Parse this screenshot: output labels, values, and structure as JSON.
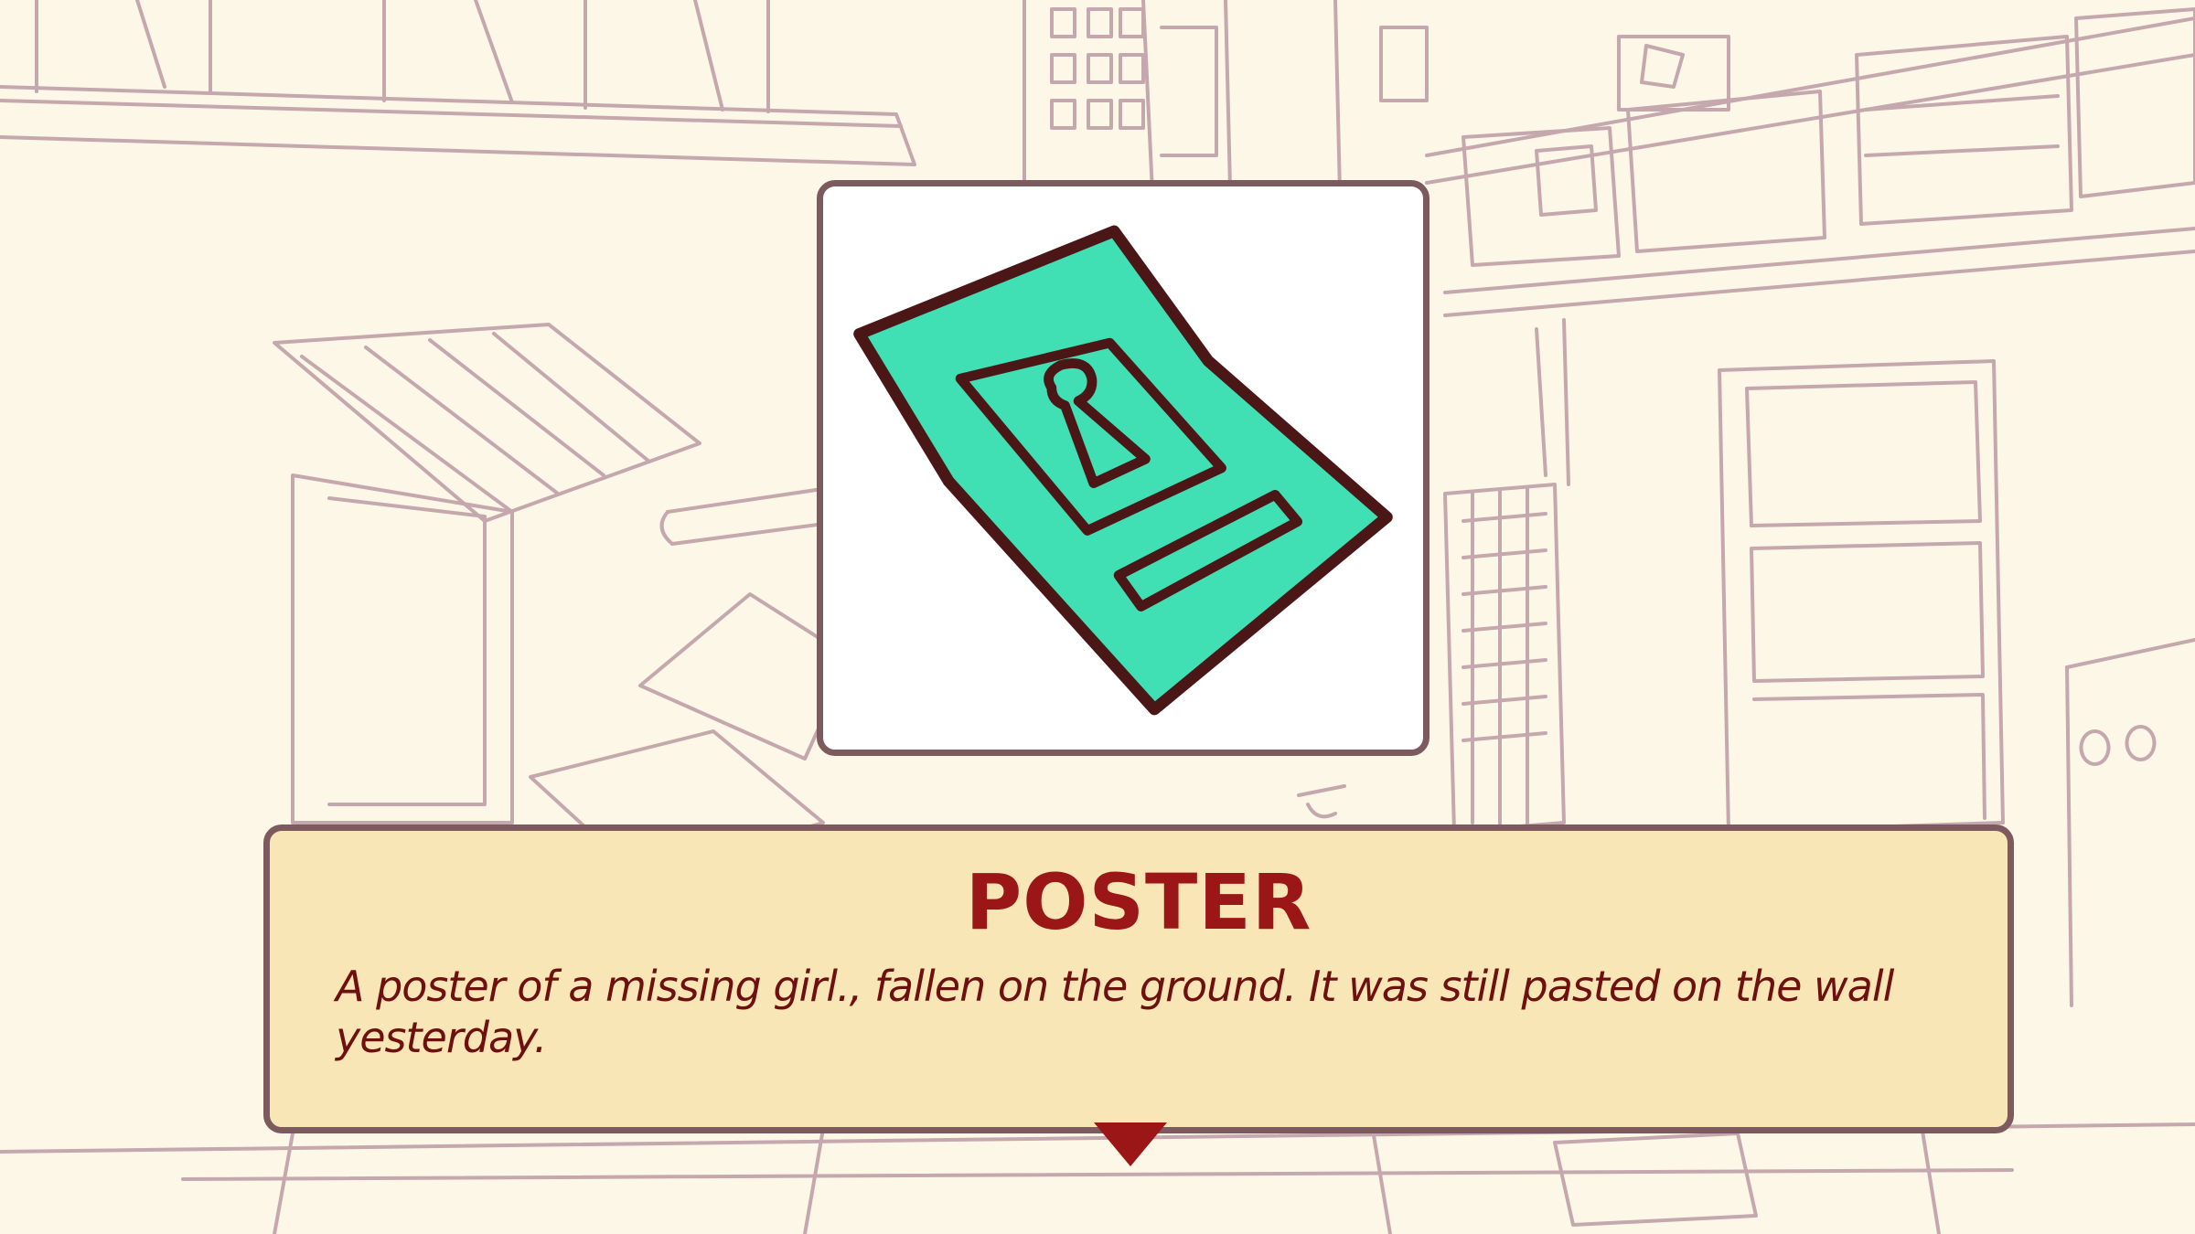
{
  "dialog": {
    "title": "POSTER",
    "description": "A poster of a missing girl., fallen on the ground. It was still pasted on the wall yesterday."
  },
  "item": {
    "icon": "missing-poster-icon",
    "colors": {
      "paper": "#40e0b4",
      "ink": "#4a1616"
    }
  },
  "colors": {
    "background": "#fdf7e8",
    "sketch_line": "#c4a8ae",
    "panel_border": "#7d5a5e",
    "dialog_fill": "#f9e6b7",
    "title_text": "#9b1616",
    "body_text": "#6e1010",
    "advance_indicator": "#9b1616"
  }
}
